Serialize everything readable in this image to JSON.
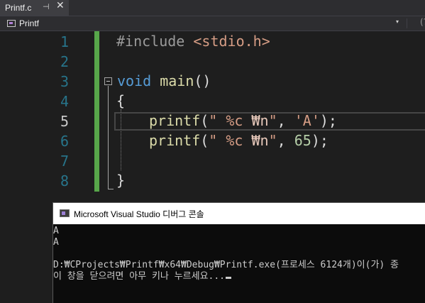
{
  "tab": {
    "name": "Printf.c",
    "pin_glyph": "⊣",
    "close_glyph": "✕"
  },
  "navbar": {
    "scope": "Printf",
    "arrow_glyph": "▾",
    "more_glyph": "(?"
  },
  "editor": {
    "current_line": 5,
    "line_numbers": [
      "1",
      "2",
      "3",
      "4",
      "5",
      "6",
      "7",
      "8"
    ],
    "code": {
      "l1_directive": "#include",
      "l1_header": "<stdio.h>",
      "l3_keyword": "void",
      "l3_name": "main",
      "l3_parens": "()",
      "l4_brace": "{",
      "l5_fn": "printf",
      "l5_open": "(",
      "l5_fmt_a": "\" %c ",
      "l5_esc": "₩n",
      "l5_fmt_b": "\"",
      "l5_comma": ", ",
      "l5_char": "'A'",
      "l5_close": ");",
      "l6_fn": "printf",
      "l6_open": "(",
      "l6_fmt_a": "\" %c ",
      "l6_esc": "₩n",
      "l6_fmt_b": "\"",
      "l6_comma": ", ",
      "l6_num": "65",
      "l6_close": ");",
      "l8_brace": "}"
    }
  },
  "console": {
    "title": "Microsoft Visual Studio 디버그 콘솔",
    "lines": [
      "A",
      "A",
      "",
      "D:₩CProjects₩Printf₩x64₩Debug₩Printf.exe(프로세스 6124개)이(가) 종",
      "이 창을 닫으려면 아무 키나 누르세요..."
    ]
  }
}
